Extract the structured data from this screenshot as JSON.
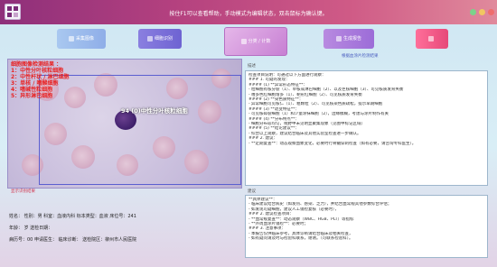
{
  "app": {
    "title": "按住F1可以查看帮助，手动模式为编辑状态，双击鼠标为确认键。"
  },
  "colors": {
    "accent": "#b4417f",
    "overlay_text": "#e82222",
    "box": "#5b5fd0"
  },
  "toolbar": {
    "buttons": [
      {
        "name": "btn-1",
        "label": "采集图像",
        "icon": "camera-icon"
      },
      {
        "name": "btn-2",
        "label": "细胞识别",
        "icon": "scan-icon"
      },
      {
        "name": "btn-3",
        "label": "分类 / 计数",
        "icon": "grid-icon"
      },
      {
        "name": "btn-4",
        "label": "生成报告",
        "icon": "report-icon"
      },
      {
        "name": "btn-5",
        "label": "",
        "icon": "print-icon"
      }
    ],
    "caption": "根据血涂片检测结果"
  },
  "image": {
    "overlay_lines": [
      "细胞图像检测结果 ：",
      "1：中性分叶核粒细胞",
      "2：中性杆状 / 淋巴细胞",
      "3：单核 / 嗜酸细胞",
      "4：嗜碱性粒细胞",
      "5：异形淋巴细胞"
    ],
    "cell_label": "94 (0)中性分叶核粒细胞",
    "caption_below": "显示识别结果"
  },
  "patient": {
    "line1": "姓名： 性别：男 科室：血液内科 标本类型：血液 床位号：241",
    "line2": "年龄： 岁 送检日期：",
    "line3": "病历号：00 申请医生： 临床诊断： 送检院区：柳州市人民医院"
  },
  "report_top": {
    "heading": "描述",
    "lines": [
      "检查项目说明：可通过以下方面进行观察：",
      "### 1. 可疑的发现：",
      "#### (1) **异常形态特征**：",
      "- 粒细胞有核分裂（1）、单核或淋巴细胞（2）、以及巨核细胞（3）、可见核质发育失衡",
      "- 嗜多色红细胞增多（1）、靶形红细胞（2）、可见核质发育失衡",
      "#### (2) **染色质特征**：",
      "- 异常细胞可见核仁（1）、粗颗粒（2）、可见核染色质疏松，提示早期细胞",
      "#### (3) **退变特征**：",
      "- 可见核碎裂细胞（1）和少量涂抹细胞（2），边缘模糊，考虑与涂片制作有关",
      "#### (4) **分布特点**：",
      "- 细胞分布较均匀，视野中未见明显聚集现象（见图中标记区域）",
      "#### (5) **结论建议**：",
      "- 综合以上观察，建议结合临床及其他实验室检查进一步确认。",
      "### 2. 建议：",
      "- **定期复查**：动态观察血象变化，必要时行骨髓穿刺检查（如有必要，请咨询专科医生）。"
    ]
  },
  "report_bottom": {
    "heading": "建议",
    "lines": [
      "**具体建议**：",
      "- 临床建议结合病史（如发热、感染、乏力），并结合血常规其他参数综合评估；",
      "- 如发现可疑细胞，建议人工镜检复核（必要时），",
      "### 2. 建议检查项目：",
      "- **血常规复查**：动态观察（WBC、HGB、PLT）等指标",
      "- **外周血涂片镜检**：必要时；",
      "### 3. 注意事项：",
      "- 本报告仅供临床参考，具体诊断请结合临床及相关检查，",
      "- 如有疑问请及时与检验科联系，谢谢。（可联系检验科）。"
    ]
  }
}
